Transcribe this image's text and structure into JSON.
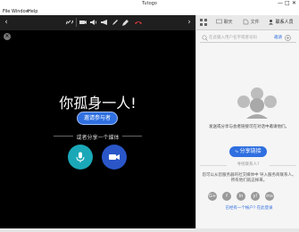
{
  "window": {
    "title": "Tutogo",
    "controls": [
      "—",
      "□",
      "✕"
    ]
  },
  "menu": [
    "File",
    "Window",
    "Help"
  ],
  "toolbar": {
    "icons": [
      "link-icon",
      "camera-icon",
      "speaker-icon",
      "megaphone-icon",
      "pen-icon",
      "edit-icon",
      "hangup-icon",
      "mic-icon"
    ]
  },
  "main": {
    "alone_text": "你孤身一人!",
    "invite_label": "邀请参与者",
    "share_media_label": "或者分享一个媒体"
  },
  "side": {
    "tabs": [
      "聊天",
      "文件",
      "联系人员"
    ],
    "search_placeholder": "在此输入用户名字或者号码",
    "invite_link": "邀请",
    "hint": "发送或分享与会者链接可在对话中邀请他们。",
    "share_link_label": "分享链接",
    "find_label": "寻找联系人?",
    "find_text": "您可以从您服务器的社交媒体中 导入服务商联系人。所有他们就这样来。",
    "socials": [
      "G+",
      "f",
      "in",
      "y!",
      "ms"
    ],
    "sent_link": "已经有一个帐户? 在此登录"
  },
  "colors": {
    "accent": "#2f6fe0",
    "mic_bg": "#1aa8b8",
    "cam_bg": "#2a56c8"
  }
}
